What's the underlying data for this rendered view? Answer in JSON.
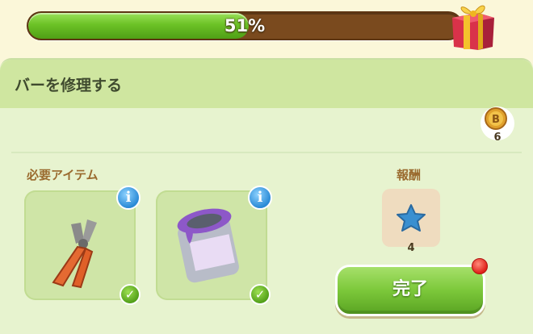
{
  "progress": {
    "value": 0.51,
    "label": "51%"
  },
  "panel": {
    "title": "バーを修理する"
  },
  "coin": {
    "count": "6"
  },
  "required": {
    "label": "必要アイテム",
    "items": [
      {
        "icon": "pliers-icon"
      },
      {
        "icon": "paint-can-icon"
      }
    ]
  },
  "reward": {
    "label": "報酬",
    "count": "4",
    "icon": "blue-star-icon"
  },
  "done_button": {
    "label": "完了"
  },
  "colors": {
    "accent": "#6cc226",
    "panel": "#e7f3cf",
    "header": "#cfe6a0",
    "label": "#9a6a2e"
  }
}
